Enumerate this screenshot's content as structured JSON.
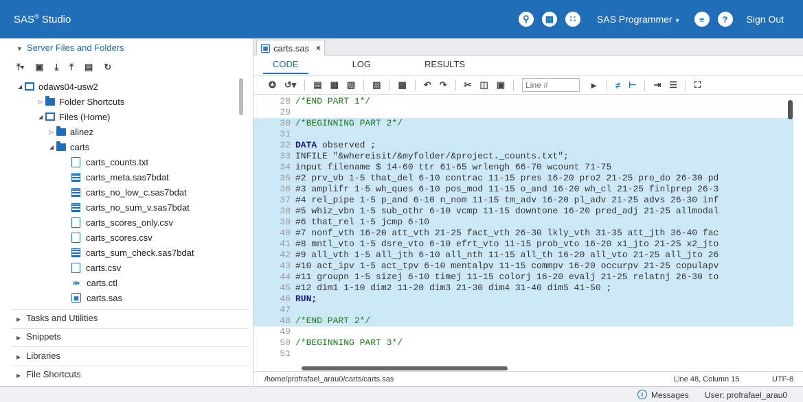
{
  "app": {
    "title": "SAS",
    "title_sup": "®",
    "title_rest": " Studio"
  },
  "header": {
    "icons": [
      "search-icon",
      "printer-icon",
      "grid-icon",
      "menu-icon",
      "help-icon"
    ],
    "role": "SAS Programmer",
    "role_caret": "▼",
    "help_glyph": "?",
    "sign_out": "Sign Out"
  },
  "sidebar": {
    "server_files": "Server Files and Folders",
    "server": "odaws04-usw2",
    "folder_shortcuts": "Folder Shortcuts",
    "files_home": "Files (Home)",
    "folders": [
      "alinez",
      "carts"
    ],
    "files": [
      {
        "name": "carts_counts.txt",
        "type": "text"
      },
      {
        "name": "carts_meta.sas7bdat",
        "type": "dataset"
      },
      {
        "name": "carts_no_low_c.sas7bdat",
        "type": "dataset"
      },
      {
        "name": "carts_no_sum_v.sas7bdat",
        "type": "dataset"
      },
      {
        "name": "carts_scores_only.csv",
        "type": "csv"
      },
      {
        "name": "carts_scores.csv",
        "type": "csv"
      },
      {
        "name": "carts_sum_check.sas7bdat",
        "type": "dataset"
      },
      {
        "name": "carts.csv",
        "type": "csv"
      },
      {
        "name": "carts.ctl",
        "type": "ctl"
      },
      {
        "name": "carts.sas",
        "type": "sas"
      }
    ],
    "sections": [
      "Tasks and Utilities",
      "Snippets",
      "Libraries",
      "File Shortcuts"
    ]
  },
  "editor": {
    "tab_label": "carts.sas",
    "tab_close": "×",
    "subtabs": [
      "CODE",
      "LOG",
      "RESULTS"
    ],
    "line_placeholder": "Line #",
    "code_lines": [
      {
        "n": "28",
        "text": "/*END PART 1*/",
        "kind": "comment",
        "sel": false
      },
      {
        "n": "29",
        "text": "",
        "kind": "norm",
        "sel": false
      },
      {
        "n": "30",
        "text": "/*BEGINNING PART 2*/",
        "kind": "comment",
        "sel": true
      },
      {
        "n": "31",
        "text": "",
        "kind": "norm",
        "sel": true
      },
      {
        "n": "32",
        "text": "DATA observed ;",
        "kind": "data",
        "sel": true
      },
      {
        "n": "33",
        "text": "INFILE \"&whereisit/&myfolder/&project._counts.txt\";",
        "kind": "norm",
        "sel": true
      },
      {
        "n": "34",
        "text": "input filename $ 14-60 ttr 61-65 wrlengh 66-70 wcount 71-75",
        "kind": "norm",
        "sel": true
      },
      {
        "n": "35",
        "text": "#2 prv_vb 1-5 that_del 6-10 contrac 11-15 pres 16-20 pro2 21-25 pro_do 26-30 pd",
        "kind": "norm",
        "sel": true
      },
      {
        "n": "36",
        "text": "#3 amplifr 1-5 wh_ques 6-10 pos_mod 11-15 o_and 16-20 wh_cl 21-25 finlprep 26-3",
        "kind": "norm",
        "sel": true
      },
      {
        "n": "37",
        "text": "#4 rel_pipe 1-5 p_and 6-10 n_nom 11-15 tm_adv 16-20 pl_adv 21-25 advs 26-30 inf",
        "kind": "norm",
        "sel": true
      },
      {
        "n": "38",
        "text": "#5 whiz_vbn 1-5 sub_othr 6-10 vcmp 11-15 downtone 16-20 pred_adj 21-25 allmodal",
        "kind": "norm",
        "sel": true
      },
      {
        "n": "39",
        "text": "#6 that_rel 1-5 jcmp 6-10",
        "kind": "norm",
        "sel": true
      },
      {
        "n": "40",
        "text": "#7 nonf_vth 16-20 att_vth 21-25 fact_vth 26-30 lkly_vth 31-35 att_jth 36-40 fac",
        "kind": "norm",
        "sel": true
      },
      {
        "n": "41",
        "text": "#8 mntl_vto 1-5 dsre_vto 6-10 efrt_vto 11-15 prob_vto 16-20 x1_jto 21-25 x2_jto",
        "kind": "norm",
        "sel": true
      },
      {
        "n": "42",
        "text": "#9 all_vth 1-5 all_jth 6-10 all_nth 11-15 all_th 16-20 all_vto 21-25 all_jto 26",
        "kind": "norm",
        "sel": true
      },
      {
        "n": "43",
        "text": "#10 act_ipv 1-5 act_tpv 6-10 mentalpv 11-15 commpv 16-20 occurpv 21-25 copulapv",
        "kind": "norm",
        "sel": true
      },
      {
        "n": "44",
        "text": "#11 groupn 1-5 sizej 6-10 timej 11-15 colorj 16-20 evalj 21-25 relatnj 26-30 to",
        "kind": "norm",
        "sel": true
      },
      {
        "n": "45",
        "text": "#12 dim1 1-10 dim2 11-20 dim3 21-30 dim4 31-40 dim5 41-50 ;",
        "kind": "norm",
        "sel": true
      },
      {
        "n": "46",
        "text": "RUN;",
        "kind": "kw",
        "sel": true
      },
      {
        "n": "47",
        "text": "",
        "kind": "norm",
        "sel": true
      },
      {
        "n": "48",
        "text": "/*END PART 2*/",
        "kind": "comment",
        "sel": true
      },
      {
        "n": "49",
        "text": "",
        "kind": "norm",
        "sel": false
      },
      {
        "n": "50",
        "text": "/*BEGINNING PART 3*/",
        "kind": "comment",
        "sel": false
      },
      {
        "n": "51",
        "text": "",
        "kind": "norm",
        "sel": false
      }
    ],
    "status_path": "/home/profrafael_arau0/carts/carts.sas",
    "status_position": "Line 48, Column 15",
    "status_encoding": "UTF-8"
  },
  "footer": {
    "messages": "Messages",
    "user": "User: profrafael_arau0"
  },
  "colors": {
    "brand": "#1f6eb7",
    "selection": "#cce8f7"
  }
}
